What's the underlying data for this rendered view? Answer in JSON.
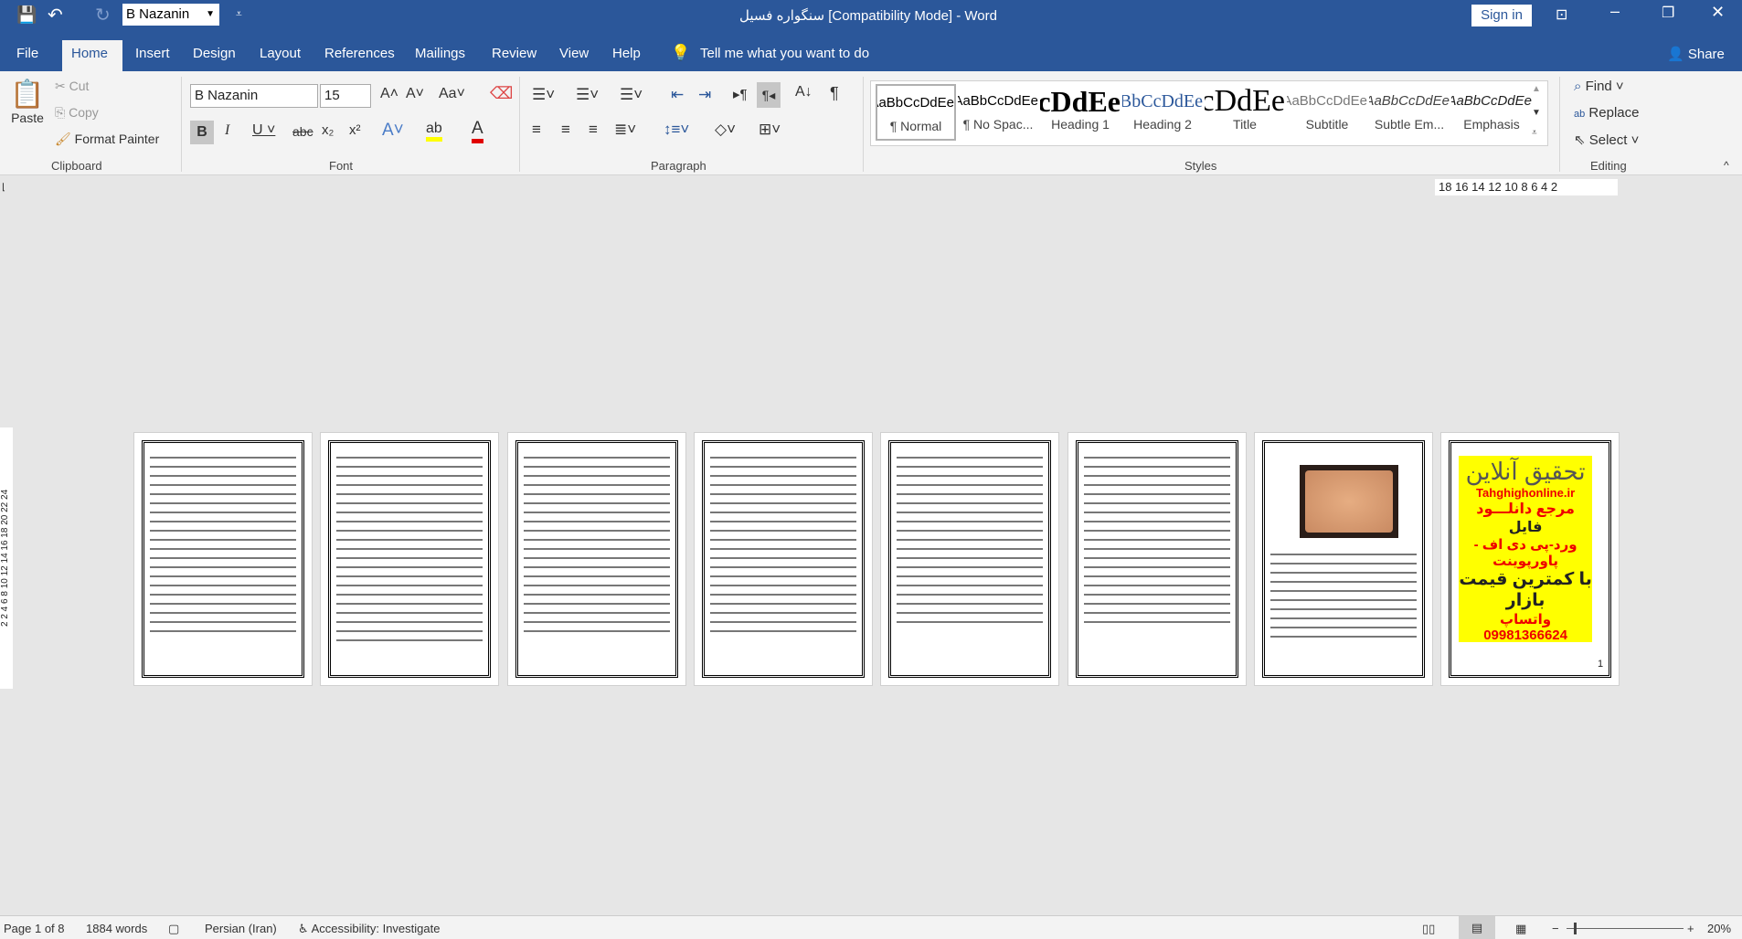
{
  "qat": {
    "font_value": "B Nazanin"
  },
  "title": "سنگواره فسیل [Compatibility Mode]  -  Word",
  "sign_in": "Sign in",
  "tabs": [
    "File",
    "Home",
    "Insert",
    "Design",
    "Layout",
    "References",
    "Mailings",
    "Review",
    "View",
    "Help"
  ],
  "tell_me": "Tell me what you want to do",
  "share": "Share",
  "clipboard": {
    "paste": "Paste",
    "cut": "Cut",
    "copy": "Copy",
    "format_painter": "Format Painter",
    "label": "Clipboard"
  },
  "font": {
    "name": "B Nazanin",
    "size": "15",
    "label": "Font",
    "highlight_color": "#ffff00",
    "font_color": "#e00000"
  },
  "paragraph": {
    "label": "Paragraph"
  },
  "styles": {
    "label": "Styles",
    "items": [
      {
        "preview": "AaBbCcDdEe",
        "name": "¶ Normal"
      },
      {
        "preview": "AaBbCcDdEe",
        "name": "¶ No Spac..."
      },
      {
        "preview": "AaBbCcDdEe",
        "name": "Heading 1"
      },
      {
        "preview": "AaBbCcDdEe",
        "name": "Heading 2"
      },
      {
        "preview": "AaBbCcDdEe",
        "name": "Title"
      },
      {
        "preview": "AaBbCcDdEe",
        "name": "Subtitle"
      },
      {
        "preview": "AaBbCcDdEe",
        "name": "Subtle Em..."
      },
      {
        "preview": "AaBbCcDdEe",
        "name": "Emphasis"
      }
    ]
  },
  "editing": {
    "find": "Find",
    "replace": "Replace",
    "select": "Select",
    "label": "Editing"
  },
  "ruler": {
    "ticks": "18 16 14 12 10 8 6 4 2"
  },
  "vruler": {
    "ticks": "2 2 4 6 8 10 12 14 16 18 20 22 24"
  },
  "pages": {
    "last_page_number": "1",
    "ad": {
      "line1": "تحقیق آنلاین",
      "site": "Tahghighonline.ir",
      "line2": "مرجع دانلـــود",
      "line3": "فایل",
      "line4": "ورد-پی دی اف - پاورپوینت",
      "line5": "با کمترین قیمت بازار",
      "phone": "09981366624",
      "whatsapp": "واتساپ"
    }
  },
  "status": {
    "page": "Page 1 of 8",
    "words": "1884 words",
    "language": "Persian (Iran)",
    "accessibility": "Accessibility: Investigate",
    "zoom": "20%"
  }
}
